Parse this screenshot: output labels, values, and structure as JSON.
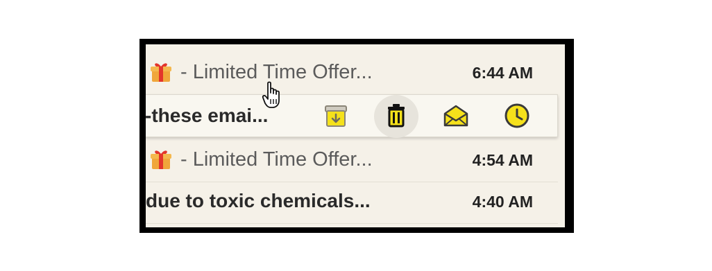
{
  "emails": [
    {
      "has_gift_icon": true,
      "subject": "- Limited Time Offer...",
      "time": "6:44 AM",
      "bold": false
    },
    {
      "has_gift_icon": false,
      "subject": "-these emai...",
      "time": "",
      "bold": true,
      "hovered": true,
      "actions": [
        {
          "name": "archive",
          "icon": "archive-icon"
        },
        {
          "name": "delete",
          "icon": "trash-icon"
        },
        {
          "name": "mark-read",
          "icon": "envelope-open-icon"
        },
        {
          "name": "snooze",
          "icon": "clock-icon"
        }
      ]
    },
    {
      "has_gift_icon": true,
      "subject": "- Limited Time Offer...",
      "time": "4:54 AM",
      "bold": false
    },
    {
      "has_gift_icon": false,
      "subject": "due to toxic chemicals...",
      "time": "4:40 AM",
      "bold": true
    }
  ],
  "colors": {
    "accent_yellow": "#f5e11b",
    "icon_stroke": "#3a3a3a",
    "background": "#f5f1e8"
  }
}
